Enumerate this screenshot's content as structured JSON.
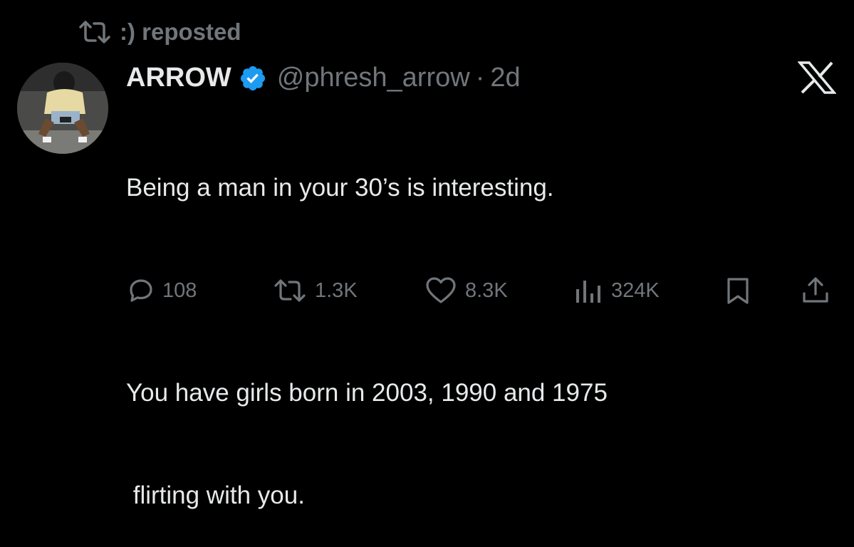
{
  "repost": {
    "icon": "repost-icon",
    "text": ":) reposted"
  },
  "author": {
    "name": "ARROW",
    "verified_icon": "verified-badge-icon",
    "verified_color": "#1d9bf0",
    "handle": "@phresh_arrow",
    "separator": "·",
    "time": "2d"
  },
  "close_icon": "x-logo-icon",
  "tweet": {
    "line1": "Being a man in your 30’s is interesting.",
    "line2": "You have girls born in 2003, 1990 and 1975",
    "line3": " flirting with you."
  },
  "actions": {
    "replies": "108",
    "reposts": "1.3K",
    "likes": "8.3K",
    "views": "324K",
    "icons": [
      "reply-icon",
      "repost-icon",
      "like-icon",
      "views-icon",
      "bookmark-icon",
      "share-icon"
    ]
  },
  "colors": {
    "background": "#000000",
    "primary_text": "#e7e9ea",
    "secondary_text": "#71767b"
  }
}
